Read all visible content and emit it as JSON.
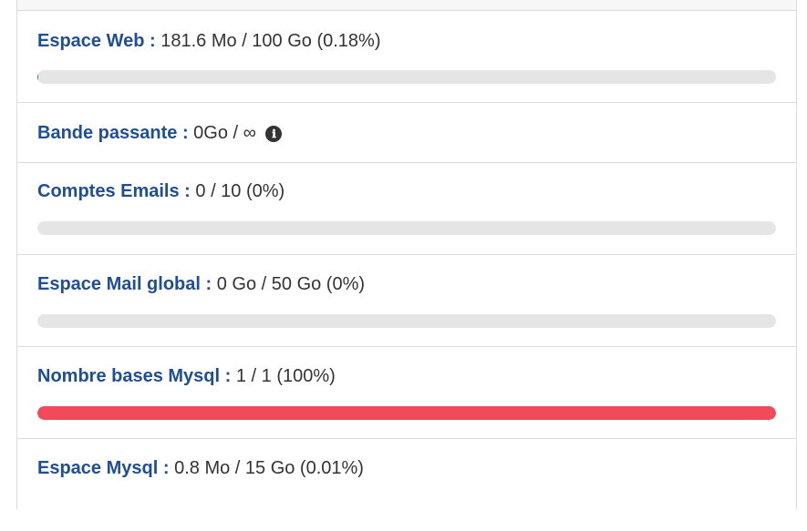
{
  "quotas": [
    {
      "label": "Espace Web :",
      "value": "181.6 Mo / 100 Go (0.18%)",
      "percent": 0.18,
      "status": "ok"
    },
    {
      "label": "Bande passante :",
      "value": "0Go / ∞",
      "info_icon": "ℹ"
    },
    {
      "label": "Comptes Emails :",
      "value": "0 / 10 (0%)",
      "percent": 0,
      "status": "ok"
    },
    {
      "label": "Espace Mail global :",
      "value": "0 Go / 50 Go (0%)",
      "percent": 0,
      "status": "ok"
    },
    {
      "label": "Nombre bases Mysql :",
      "value": "1 / 1 (100%)",
      "percent": 100,
      "status": "full"
    },
    {
      "label": "Espace Mysql :",
      "value": "0.8 Mo / 15 Go (0.01%)",
      "percent": 0.01,
      "status": "ok"
    }
  ],
  "colors": {
    "label": "#1f4e96",
    "text": "#333333",
    "bar_track": "#e5e5e5",
    "bar_ok": "#2e9e44",
    "bar_full": "#f14a5b",
    "border": "#dcdcdc"
  },
  "icons": {
    "info": "info-circle-icon"
  }
}
